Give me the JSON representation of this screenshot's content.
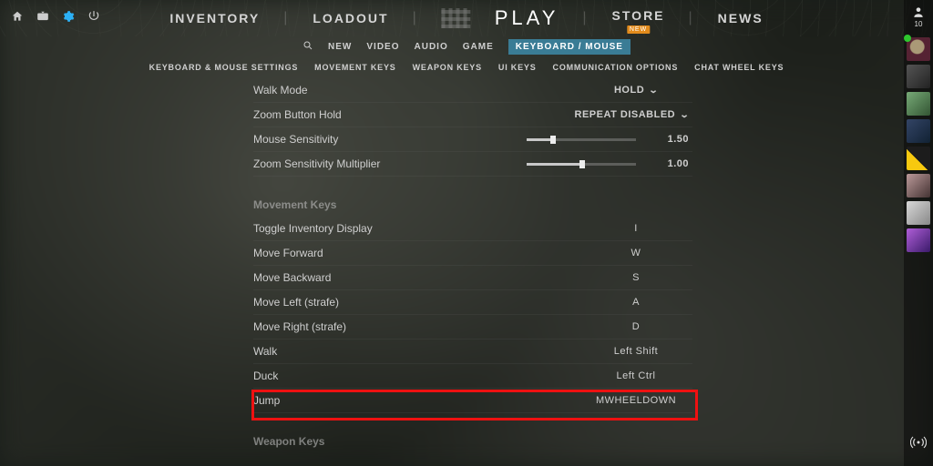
{
  "topbar": {
    "main_nav": [
      "INVENTORY",
      "LOADOUT",
      "PLAY",
      "STORE",
      "NEWS"
    ],
    "store_badge": "NEW"
  },
  "subnav": {
    "items": [
      "NEW",
      "VIDEO",
      "AUDIO",
      "GAME",
      "KEYBOARD / MOUSE"
    ],
    "active_index": 4
  },
  "tabnav": [
    "KEYBOARD & MOUSE SETTINGS",
    "MOVEMENT KEYS",
    "WEAPON KEYS",
    "UI KEYS",
    "COMMUNICATION OPTIONS",
    "CHAT WHEEL KEYS"
  ],
  "settings": {
    "walk_mode": {
      "label": "Walk Mode",
      "value": "HOLD"
    },
    "zoom_hold": {
      "label": "Zoom Button Hold",
      "value": "REPEAT DISABLED"
    },
    "mouse_sens": {
      "label": "Mouse Sensitivity",
      "value": "1.50",
      "percent": 22
    },
    "zoom_sens": {
      "label": "Zoom Sensitivity Multiplier",
      "value": "1.00",
      "percent": 48
    }
  },
  "movement": {
    "header": "Movement Keys",
    "rows": [
      {
        "label": "Toggle Inventory Display",
        "key": "I"
      },
      {
        "label": "Move Forward",
        "key": "W"
      },
      {
        "label": "Move Backward",
        "key": "S"
      },
      {
        "label": "Move Left (strafe)",
        "key": "A"
      },
      {
        "label": "Move Right (strafe)",
        "key": "D"
      },
      {
        "label": "Walk",
        "key": "Left Shift"
      },
      {
        "label": "Duck",
        "key": "Left Ctrl"
      },
      {
        "label": "Jump",
        "key": "MWHEELDOWN"
      }
    ]
  },
  "weapon": {
    "header": "Weapon Keys"
  },
  "profile": {
    "level": "10"
  }
}
